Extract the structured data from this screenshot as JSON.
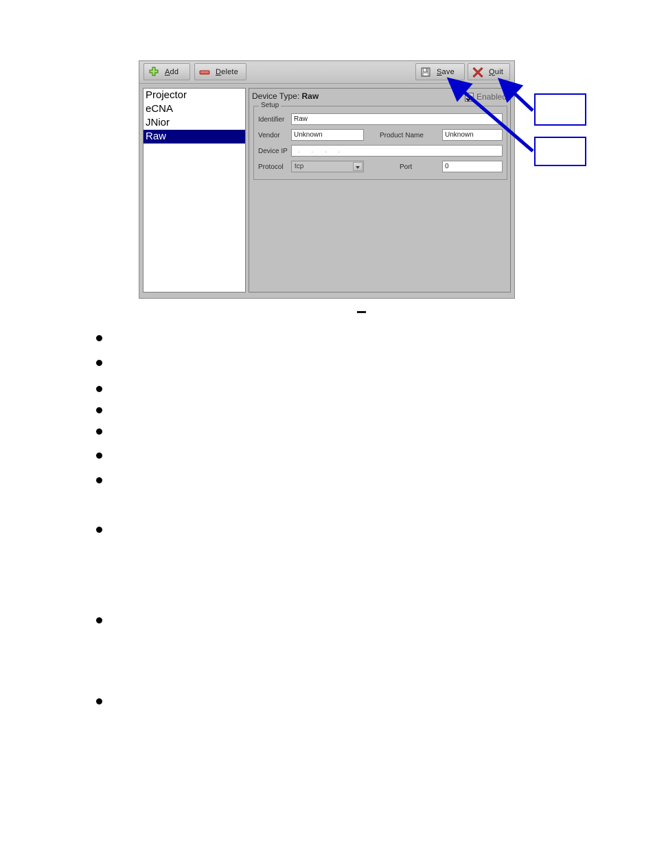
{
  "dialog": {
    "toolbar": {
      "add": {
        "label": "Add",
        "mnemonic": "A",
        "icon": "plus-icon",
        "icon_color": "#7ac943"
      },
      "delete": {
        "label": "Delete",
        "mnemonic": "D",
        "icon": "minus-icon",
        "icon_color": "#e2574c"
      },
      "save": {
        "label": "Save",
        "mnemonic": "S",
        "icon": "floppy-disk-icon",
        "icon_color": "#c8c8c8"
      },
      "quit": {
        "label": "Quit",
        "mnemonic": "Q",
        "icon": "red-x-icon",
        "icon_color": "#d03b34"
      }
    },
    "device_list": {
      "items": [
        {
          "label": "Projector",
          "selected": false
        },
        {
          "label": "eCNA",
          "selected": false
        },
        {
          "label": "JNior",
          "selected": false
        },
        {
          "label": "Raw",
          "selected": true
        }
      ],
      "selection_color": "#000080"
    },
    "detail": {
      "device_type_prefix": "Device Type:",
      "device_type_value": "Raw",
      "enabled_label": "Enabled",
      "enabled_checked": true,
      "group_title": "Setup",
      "fields": {
        "identifier": {
          "label": "Identifier",
          "value": "Raw"
        },
        "vendor": {
          "label": "Vendor",
          "value": "Unknown"
        },
        "product_name": {
          "label": "Product Name",
          "value": "Unknown"
        },
        "device_ip": {
          "label": "Device IP",
          "value": ".   .   .   ."
        },
        "protocol": {
          "label": "Protocol",
          "value": "tcp"
        },
        "port": {
          "label": "Port",
          "value": "0"
        }
      }
    }
  },
  "annotations": {
    "color": "#0000cc",
    "callouts": [
      {
        "name": "callout-quit",
        "text": "",
        "points_to": "quit-button"
      },
      {
        "name": "callout-save",
        "text": "",
        "points_to": "save-button"
      }
    ]
  },
  "document_body": {
    "dash_mark": "",
    "bullets": [
      "",
      "",
      "",
      "",
      "",
      "",
      "",
      "",
      "",
      ""
    ]
  }
}
